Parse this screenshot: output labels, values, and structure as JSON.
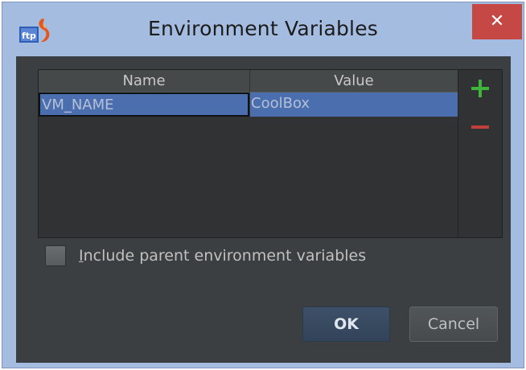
{
  "window": {
    "title": "Environment Variables",
    "close_label": "✕"
  },
  "table": {
    "columns": [
      "Name",
      "Value"
    ],
    "rows": [
      {
        "name": "VM_NAME",
        "value": "CoolBox",
        "selected": true
      }
    ]
  },
  "actions": {
    "add_icon": "plus-icon",
    "remove_icon": "minus-icon"
  },
  "options": {
    "include_parent_mnemonic": "I",
    "include_parent_rest": "nclude parent environment variables",
    "include_parent_checked": false
  },
  "buttons": {
    "ok_label": "OK",
    "cancel_label": "Cancel"
  },
  "colors": {
    "titlebar": "#a5bce1",
    "close_button": "#c64845",
    "body_background": "#3c3f41",
    "selection": "#4b6eaf",
    "add_green": "#3fb43a",
    "remove_red": "#c0413b"
  }
}
